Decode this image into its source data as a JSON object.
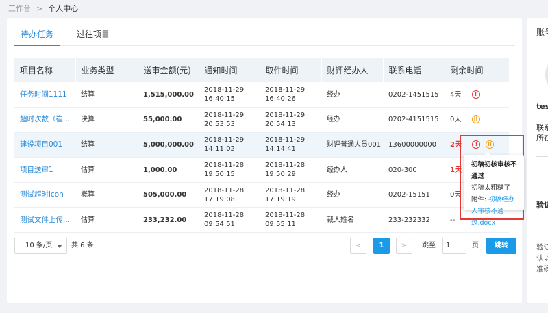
{
  "breadcrumb": {
    "root": "工作台",
    "sep": ">",
    "current": "个人中心"
  },
  "tabs": [
    {
      "label": "待办任务",
      "active": true
    },
    {
      "label": "过往项目",
      "active": false
    }
  ],
  "table": {
    "columns": [
      "项目名称",
      "业务类型",
      "送审金额(元)",
      "通知时间",
      "取件时间",
      "财评经办人",
      "联系电话",
      "剩余时间"
    ],
    "rows": [
      {
        "name": "任务时间1111",
        "type": "结算",
        "amount": "1,515,000.00",
        "notify": "2018-11-29 16:40:15",
        "pickup": "2018-11-29 16:40:26",
        "handler": "经办",
        "phone": "0202-1451515",
        "remain": "4天",
        "icons": [
          "warn"
        ]
      },
      {
        "name": "超时次数（崔...",
        "type": "决算",
        "amount": "55,000.00",
        "notify": "2018-11-29 20:53:53",
        "pickup": "2018-11-29 20:54:13",
        "handler": "经办",
        "phone": "0202-4151515",
        "remain": "0天",
        "icons": [
          "pause"
        ]
      },
      {
        "name": "建设项目001",
        "type": "结算",
        "amount": "5,000,000.00",
        "notify": "2018-11-29 14:11:02",
        "pickup": "2018-11-29 14:14:41",
        "handler": "财评普通人员001",
        "phone": "13600000000",
        "remain": "2天",
        "icons": [
          "warn",
          "pause"
        ]
      },
      {
        "name": "项目送审1",
        "type": "估算",
        "amount": "1,000.00",
        "notify": "2018-11-28 19:50:15",
        "pickup": "2018-11-28 19:50:29",
        "handler": "经办人",
        "phone": "020-300",
        "remain": "1天",
        "icons": []
      },
      {
        "name": "测试超时icon",
        "type": "概算",
        "amount": "505,000.00",
        "notify": "2018-11-28 17:19:08",
        "pickup": "2018-11-28 17:19:19",
        "handler": "经办",
        "phone": "0202-15151",
        "remain": "0天",
        "icons": []
      },
      {
        "name": "测试文件上传...",
        "type": "估算",
        "amount": "233,232.00",
        "notify": "2018-11-28 09:54:51",
        "pickup": "2018-11-28 09:55:11",
        "handler": "裁人姓名",
        "phone": "233-232332",
        "remain": "--",
        "icons": []
      }
    ]
  },
  "pagination": {
    "page_size": "10 条/页",
    "total": "共 6 条",
    "prev": "<",
    "current": "1",
    "next": ">",
    "goto_label": "跳至",
    "goto_value": "1",
    "page_unit": "页",
    "go_button": "跳转"
  },
  "popup": {
    "title": "初稿初核审核不通过",
    "line1": "初稿太粗糙了",
    "attach_label": "附件: ",
    "attach_link": "初稿经办人审核不通过.docx"
  },
  "side_panel": {
    "title": "账号",
    "username": "test",
    "contact1": "联系",
    "contact2": "所在",
    "section": "验证",
    "desc": "验证\n认以\n准确"
  },
  "colors": {
    "accent": "#2a8ad8",
    "primary_button": "#1b9ae8",
    "danger": "#e53935",
    "warning": "#f0a020"
  }
}
